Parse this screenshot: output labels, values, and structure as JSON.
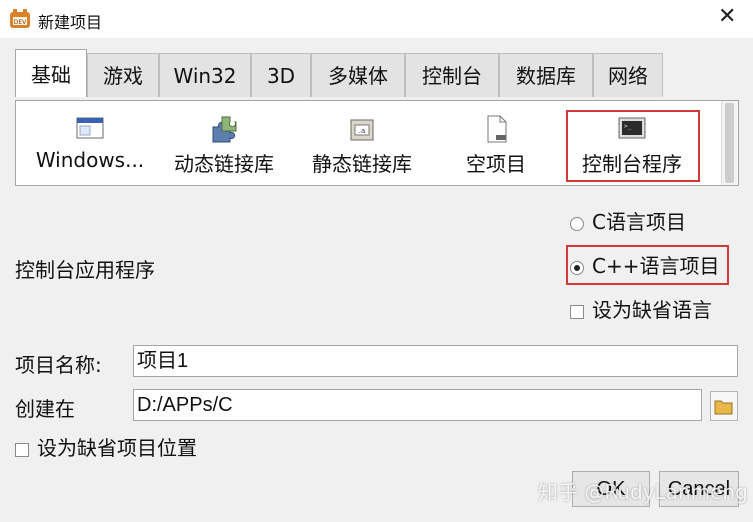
{
  "window": {
    "title": "新建项目"
  },
  "tabs": [
    {
      "label": "基础"
    },
    {
      "label": "游戏"
    },
    {
      "label": "Win32"
    },
    {
      "label": "3D"
    },
    {
      "label": "多媒体"
    },
    {
      "label": "控制台"
    },
    {
      "label": "数据库"
    },
    {
      "label": "网络"
    }
  ],
  "active_tab": "基础",
  "templates": [
    {
      "label": "Windows...",
      "icon": "window-icon"
    },
    {
      "label": "动态链接库",
      "icon": "puzzle-icon"
    },
    {
      "label": "静态链接库",
      "icon": "library-icon"
    },
    {
      "label": "空项目",
      "icon": "empty-file-icon"
    },
    {
      "label": "控制台程序",
      "icon": "console-icon"
    }
  ],
  "selected_template": "控制台程序",
  "description": "控制台应用程序",
  "language": {
    "c_label": "C语言项目",
    "cpp_label": "C++语言项目",
    "selected": "C++语言项目",
    "default_lang_label": "设为缺省语言"
  },
  "form": {
    "name_label": "项目名称:",
    "name_value": "项目1",
    "location_label": "创建在",
    "location_value": "D:/APPs/C",
    "default_location_label": "设为缺省项目位置"
  },
  "buttons": {
    "ok": "OK",
    "cancel": "Cancel"
  },
  "watermark": "知乎 @RudyLanmeng",
  "colors": {
    "highlight": "#d23a3a",
    "background": "#f0f0f0"
  }
}
